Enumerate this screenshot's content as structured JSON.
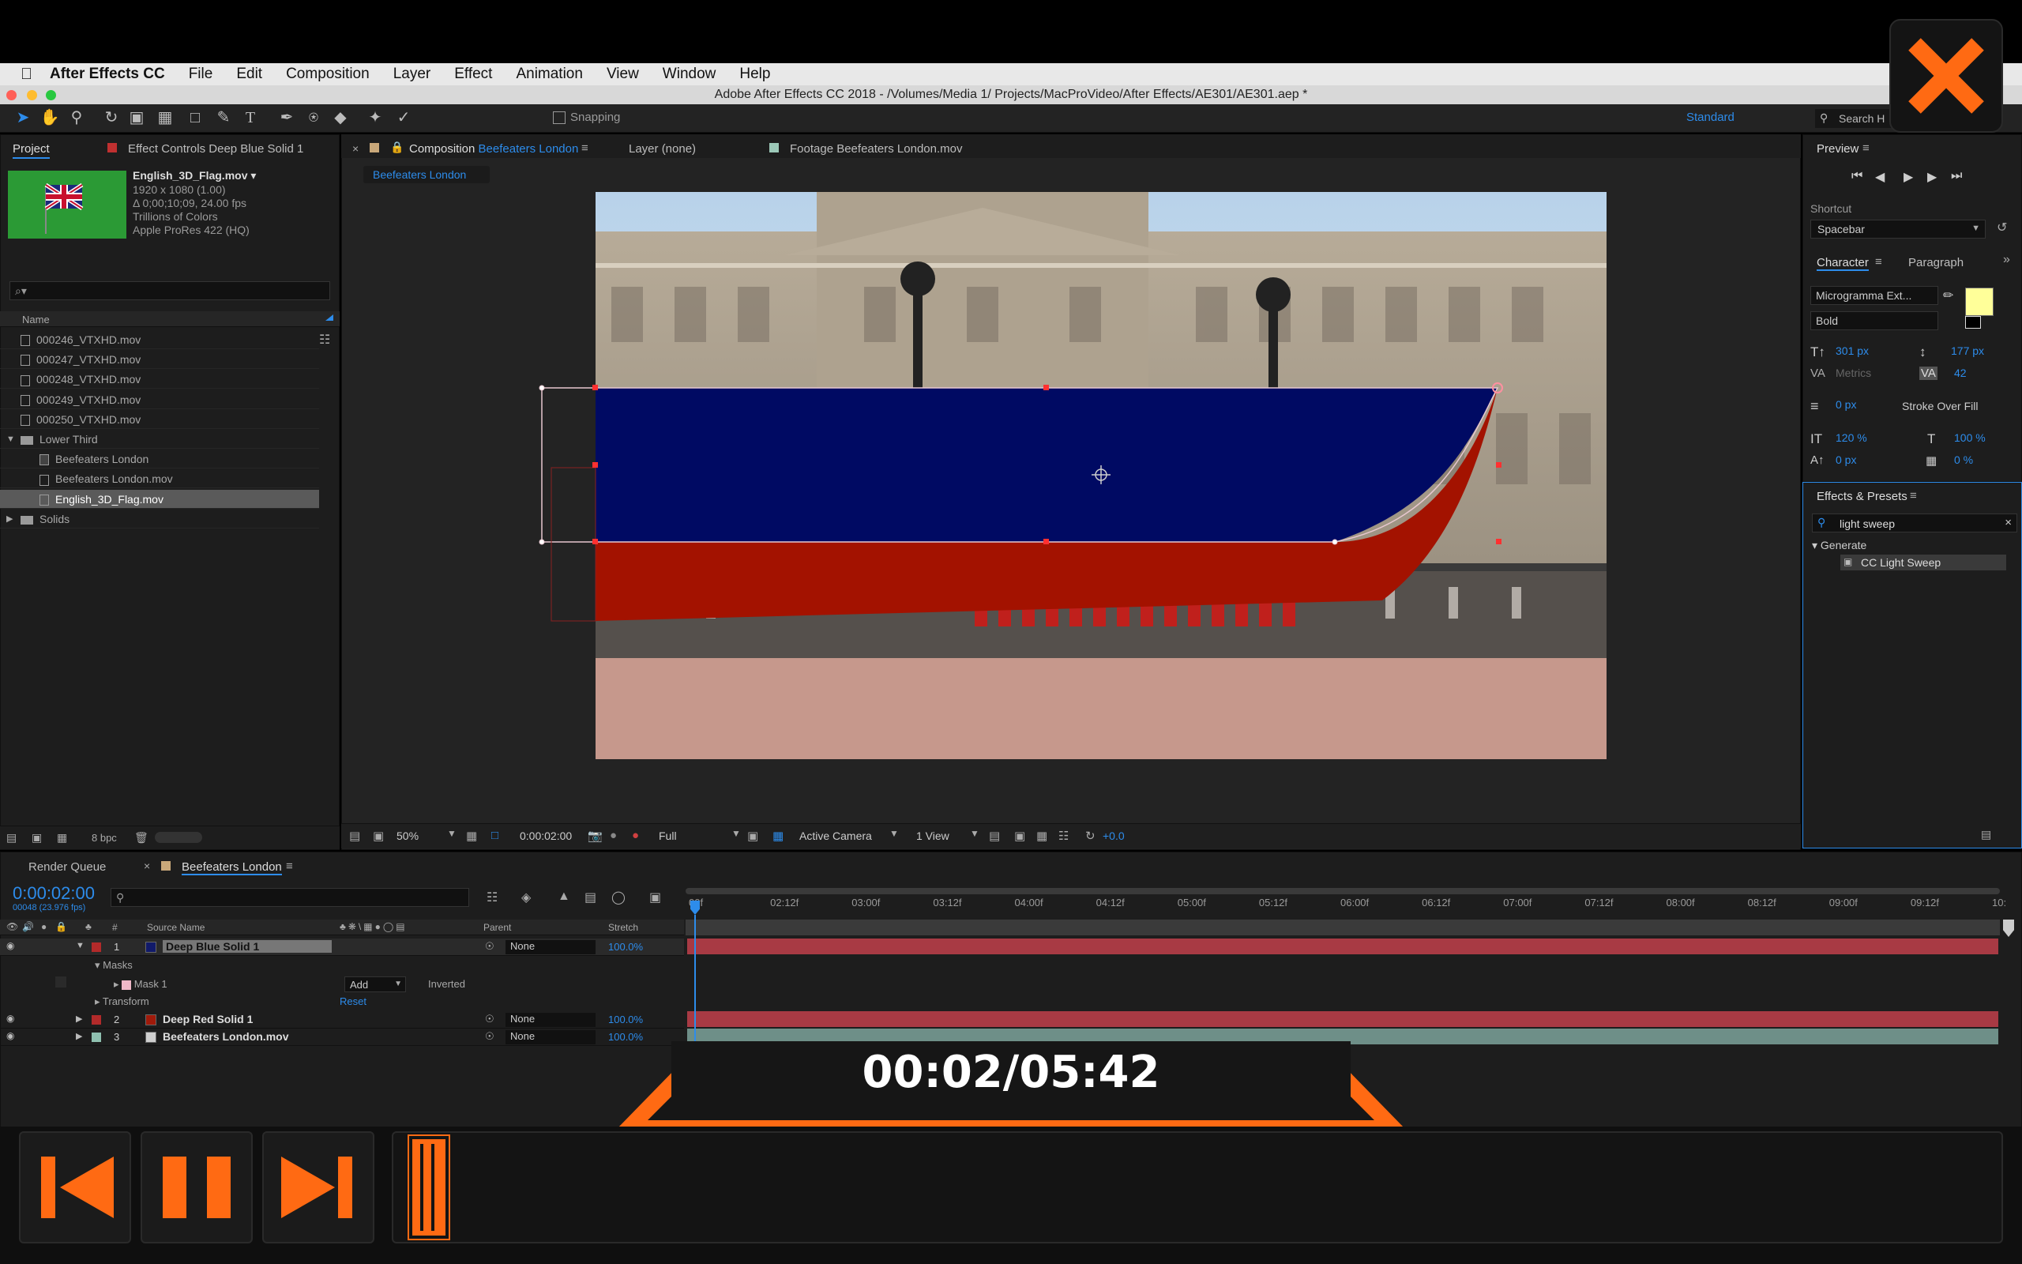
{
  "app": {
    "apple_icon": "apple-icon",
    "menu": [
      "After Effects CC",
      "File",
      "Edit",
      "Composition",
      "Layer",
      "Effect",
      "Animation",
      "View",
      "Window",
      "Help"
    ],
    "window_title": "Adobe After Effects CC 2018 - /Volumes/Media 1/      Projects/MacProVideo/After Effects/AE301/AE301.aep *"
  },
  "toolbar": {
    "snapping": "Snapping",
    "workspace": "Standard",
    "search": "Search H"
  },
  "project": {
    "tab": "Project",
    "effect_controls_tab": "Effect Controls Deep Blue Solid 1",
    "file_name": "English_3D_Flag.mov ▾",
    "file_info": [
      "1920 x 1080 (1.00)",
      "Δ 0;00;10;09, 24.00 fps",
      "Trillions of Colors",
      "Apple ProRes 422 (HQ)"
    ],
    "search_placeholder": "⌕▾",
    "column_name": "Name",
    "items": [
      {
        "label": "000246_VTXHD.mov",
        "type": "file",
        "indent": 0
      },
      {
        "label": "000247_VTXHD.mov",
        "type": "file",
        "indent": 0
      },
      {
        "label": "000248_VTXHD.mov",
        "type": "file",
        "indent": 0
      },
      {
        "label": "000249_VTXHD.mov",
        "type": "file",
        "indent": 0
      },
      {
        "label": "000250_VTXHD.mov",
        "type": "file",
        "indent": 0
      },
      {
        "label": "Lower Third",
        "type": "folder-open",
        "indent": 0
      },
      {
        "label": "Beefeaters London",
        "type": "comp",
        "indent": 1
      },
      {
        "label": "Beefeaters London.mov",
        "type": "file",
        "indent": 1
      },
      {
        "label": "English_3D_Flag.mov",
        "type": "file",
        "indent": 1,
        "selected": true
      },
      {
        "label": "Solids",
        "type": "folder",
        "indent": 0
      }
    ],
    "bpc": "8 bpc"
  },
  "comp": {
    "tab_comp_prefix": "Composition",
    "tab_comp_name": "Beefeaters London",
    "tab_layer": "Layer (none)",
    "tab_footage": "Footage Beefeaters London.mov",
    "breadcrumb": "Beefeaters London",
    "zoom": "50%",
    "timecode": "0:00:02:00",
    "resolution": "Full",
    "camera": "Active Camera",
    "views": "1 View",
    "exposure": "+0.0"
  },
  "preview": {
    "title": "Preview",
    "shortcut_label": "Shortcut",
    "shortcut_value": "Spacebar"
  },
  "character": {
    "tab": "Character",
    "tab2": "Paragraph",
    "font": "Microgramma Ext...",
    "style": "Bold",
    "font_size": "301 px",
    "leading": "177 px",
    "kerning": "Metrics",
    "tracking": "42",
    "stroke": "0 px",
    "stroke_mode": "Stroke Over Fill",
    "vscale": "120 %",
    "hscale": "100 %",
    "baseline": "0 px",
    "tsume": "0 %",
    "fill_color": "#ffff99"
  },
  "effects": {
    "title": "Effects & Presets",
    "search": "light sweep",
    "group": "Generate",
    "item": "CC Light Sweep"
  },
  "timeline": {
    "render_queue": "Render Queue",
    "comp_tab": "Beefeaters London",
    "timecode": "0:00:02:00",
    "frames": "00048 (23.976 fps)",
    "col_source": "Source Name",
    "col_parent": "Parent",
    "col_stretch": "Stretch",
    "ruler": [
      "00f",
      "02:12f",
      "03:00f",
      "03:12f",
      "04:00f",
      "04:12f",
      "05:00f",
      "05:12f",
      "06:00f",
      "06:12f",
      "07:00f",
      "07:12f",
      "08:00f",
      "08:12f",
      "09:00f",
      "09:12f",
      "10:"
    ],
    "layers": [
      {
        "num": "1",
        "name": "Deep Blue Solid 1",
        "color": "#b22a2a",
        "swatch": "#111a6a",
        "parent": "None",
        "stretch": "100.0%",
        "bar": "#a83a44"
      },
      {
        "num": "2",
        "name": "Deep Red Solid 1",
        "color": "#b22a2a",
        "swatch": "#a01a0a",
        "parent": "None",
        "stretch": "100.0%",
        "bar": "#a83a44"
      },
      {
        "num": "3",
        "name": "Beefeaters London.mov",
        "color": "#8fc0b0",
        "swatch": "#cfcfcf",
        "parent": "None",
        "stretch": "100.0%",
        "bar": "#6e8f88"
      }
    ],
    "masks_label": "Masks",
    "mask1": "Mask 1",
    "mask_mode": "Add",
    "inverted": "Inverted",
    "transform": "Transform",
    "reset": "Reset"
  },
  "player": {
    "time": "00:02/05:42",
    "progress": 0.006
  },
  "colors": {
    "accent_orange": "#ff6a13",
    "ae_blue": "#2d8ceb",
    "flag_blue": "#000a63",
    "flag_red": "#a31200"
  }
}
